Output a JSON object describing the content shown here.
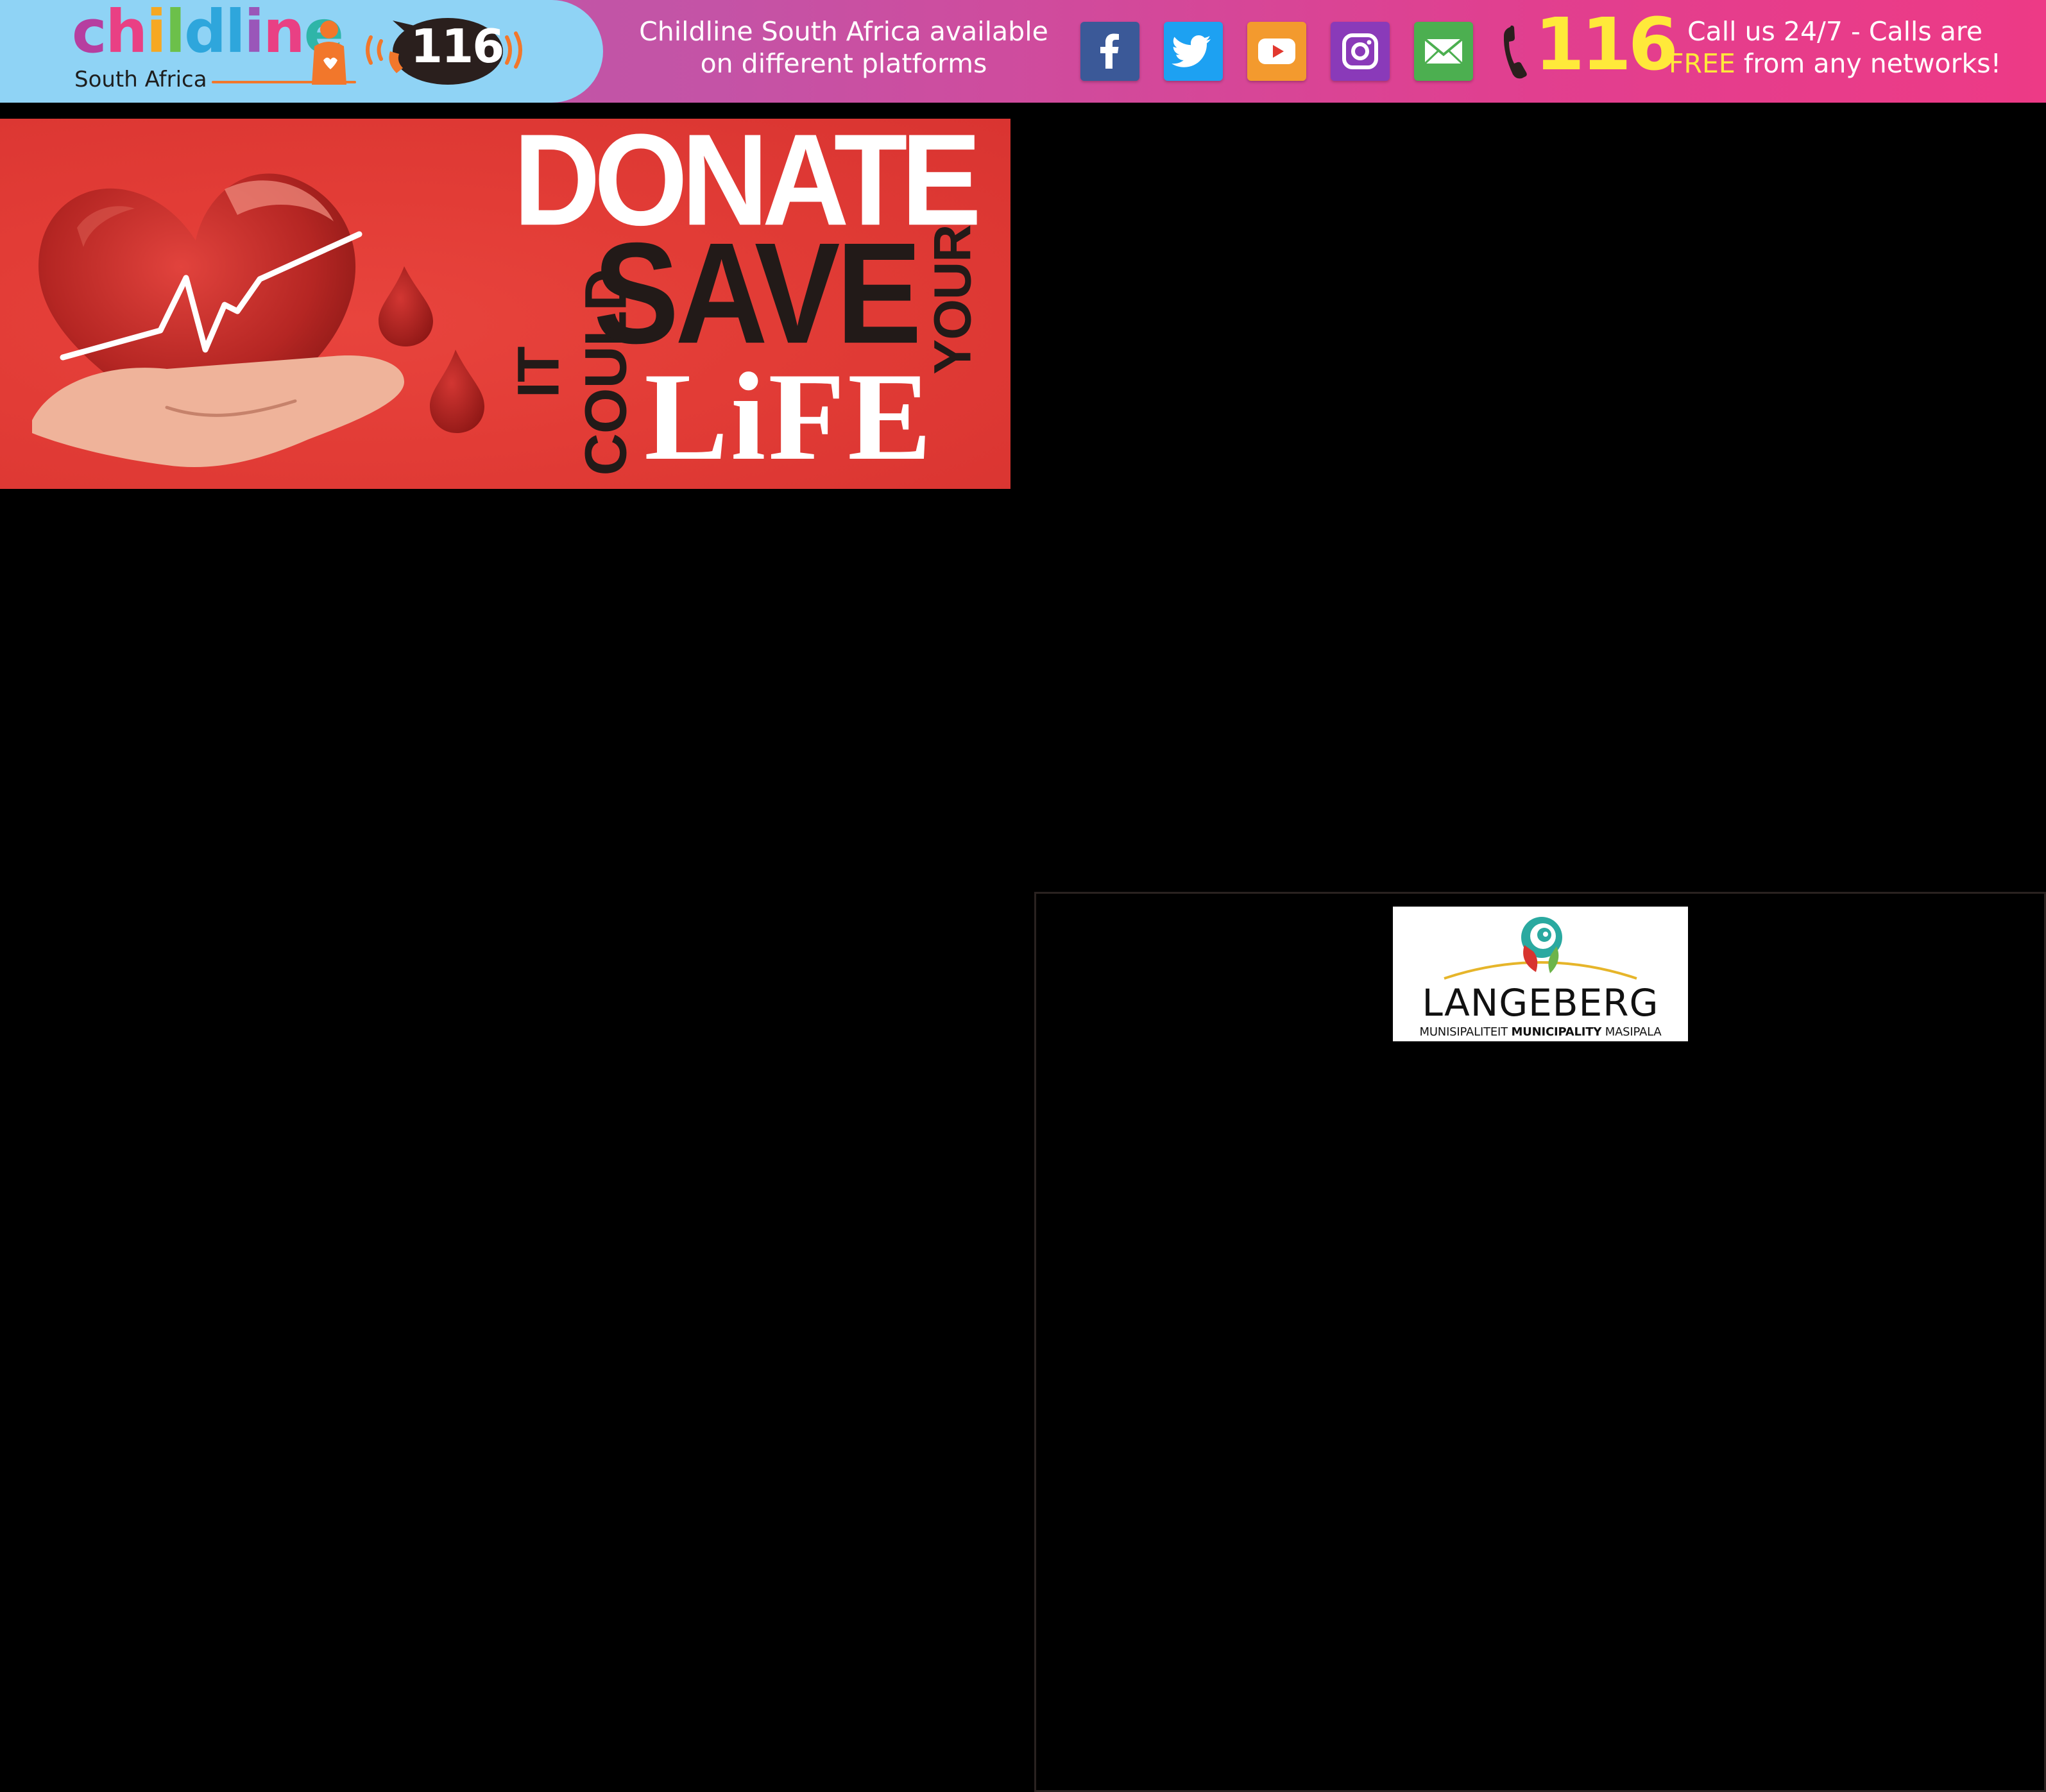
{
  "top_banner": {
    "logo": {
      "word_letters": [
        "c",
        "h",
        "i",
        "l",
        "d",
        "l",
        "i",
        "n",
        "e"
      ],
      "word_colors": [
        "#b63ea0",
        "#e94084",
        "#f6a822",
        "#6cc04a",
        "#2ea6dc",
        "#2ea6dc",
        "#9a56b9",
        "#e94084",
        "#2fb5a8"
      ],
      "subtitle": "South Africa",
      "bubble_number": "116"
    },
    "platforms_line1": "Childline South Africa available",
    "platforms_line2": "on different platforms",
    "social": [
      {
        "name": "facebook-icon",
        "color": "#3b5998"
      },
      {
        "name": "twitter-icon",
        "color": "#1da1f2"
      },
      {
        "name": "youtube-icon",
        "color": "#f39a2e"
      },
      {
        "name": "instagram-icon",
        "color": "#8a3ab9"
      },
      {
        "name": "email-icon",
        "color": "#4caf50"
      }
    ],
    "phone_number": "116",
    "call_line1": "Call us 24/7 - Calls are",
    "call_free": "FREE",
    "call_line2_rest": " from any networks!",
    "accent_yellow": "#ffe93a",
    "banner_pink": "#ed3a86",
    "logo_bg": "#8fd3f5"
  },
  "donate_banner": {
    "word_donate": "DONATE",
    "word_it_could": "IT COULD",
    "word_save": "SAVE",
    "word_your": "YOUR",
    "word_life": "LiFE",
    "bg_color": "#e23c36",
    "dark_text_color": "#221a18"
  },
  "langeberg": {
    "name": "LANGEBERG",
    "sub_left": "MUNISIPALITEIT ",
    "sub_bold": "MUNICIPALITY",
    "sub_right": " MASIPALA"
  }
}
